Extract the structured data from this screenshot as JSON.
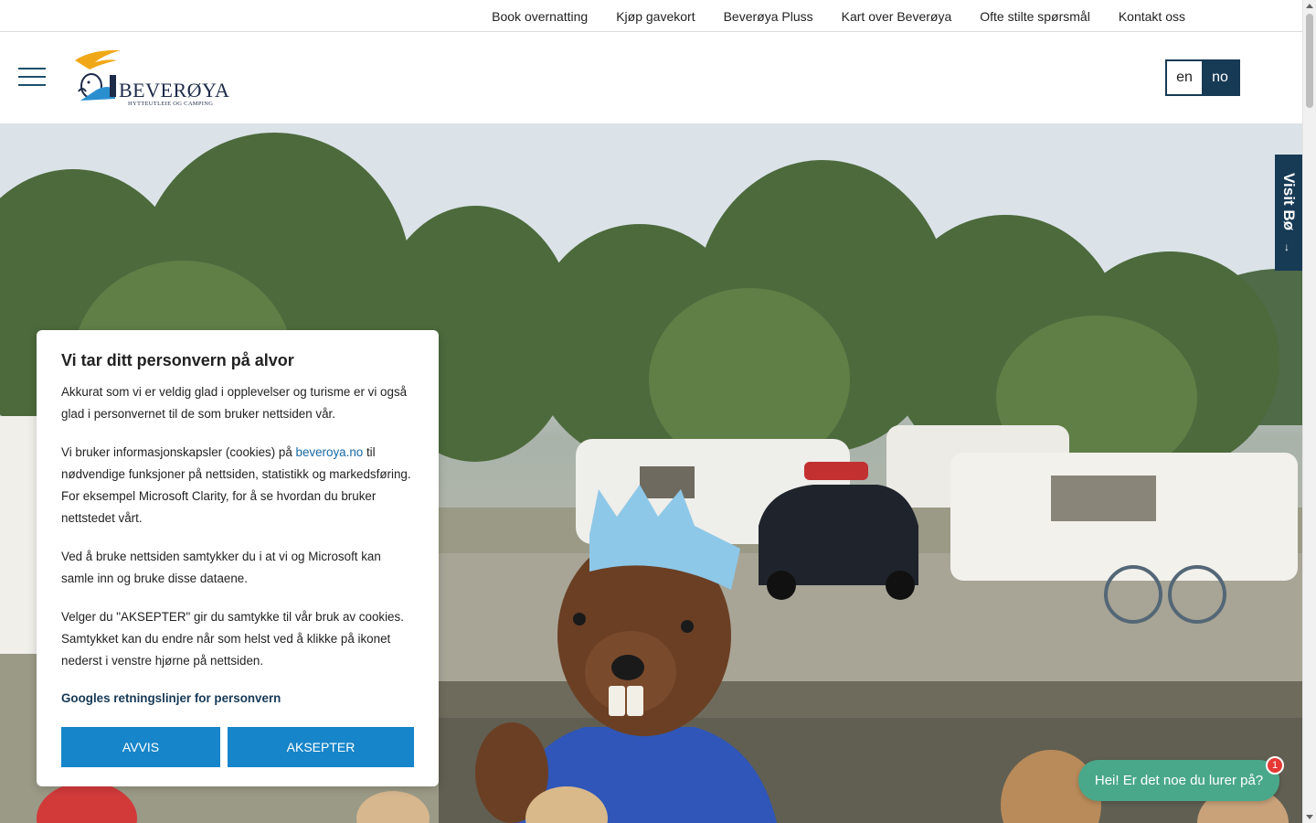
{
  "top_nav": {
    "items": [
      {
        "label": "Book overnatting"
      },
      {
        "label": "Kjøp gavekort"
      },
      {
        "label": "Beverøya Pluss"
      },
      {
        "label": "Kart over Beverøya"
      },
      {
        "label": "Ofte stilte spørsmål"
      },
      {
        "label": "Kontakt oss"
      }
    ]
  },
  "header": {
    "logo_name": "BEVERØYA",
    "logo_tagline": "HYTTEUTLEIE OG CAMPING",
    "lang_en": "en",
    "lang_no": "no"
  },
  "side_tab": {
    "label": "Visit Bø",
    "arrow": "↓"
  },
  "cookie": {
    "title": "Vi tar ditt personvern på alvor",
    "p1": "Akkurat som vi er veldig glad i opplevelser og turisme er vi også glad i personvernet til de som bruker nettsiden vår.",
    "p2_before": "Vi bruker informasjonskapsler (cookies) på ",
    "p2_link": "beveroya.no",
    "p2_after": " til nødvendige funksjoner på nettsiden, statistikk og markedsføring. For eksempel Microsoft Clarity, for å se hvordan du bruker nettstedet vårt.",
    "p3": "Ved å bruke nettsiden samtykker du i at vi og Microsoft kan samle inn og bruke disse dataene.",
    "p4": "Velger du \"AKSEPTER\" gir du samtykke til vår bruk av cookies. Samtykket kan du endre når som helst ved å klikke på ikonet nederst i venstre hjørne på nettsiden.",
    "policy_link": "Googles retningslinjer for personvern",
    "reject_label": "AVVIS",
    "accept_label": "AKSEPTER"
  },
  "chat": {
    "label": "Hei! Er det noe du lurer på?",
    "badge": "1"
  },
  "colors": {
    "navy": "#173a55",
    "button_blue": "#1785c9",
    "chat_green": "#49a88a",
    "badge_red": "#e53935"
  }
}
